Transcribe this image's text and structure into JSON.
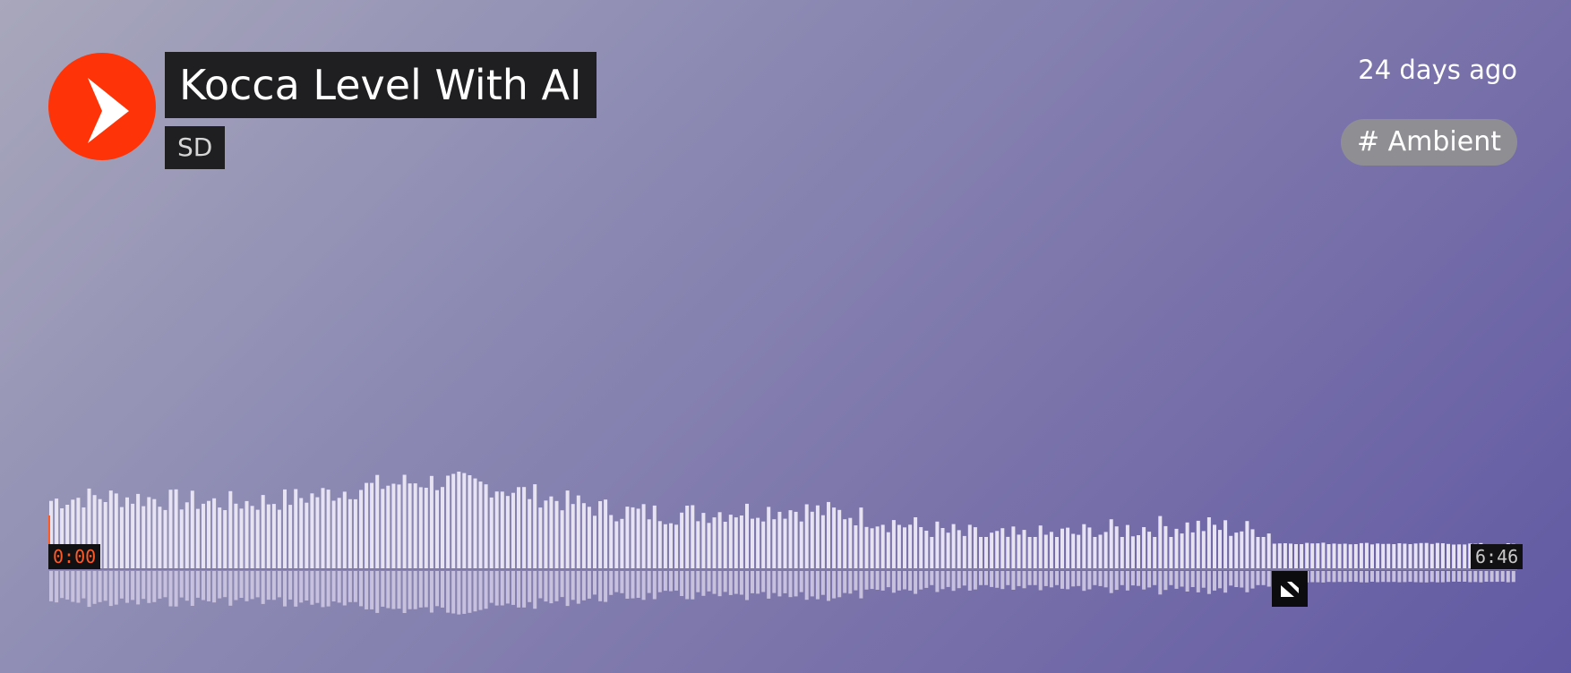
{
  "track": {
    "title": "Kocca Level With AI",
    "artist": "SD",
    "posted": "24 days ago",
    "tag": "# Ambient"
  },
  "player": {
    "current_time": "0:00",
    "duration": "6:46",
    "progress": 0,
    "played_color": "#ff5a26",
    "accent_color": "#fe3307"
  },
  "colors": {
    "title_bg": "#1f1f22",
    "tag_bg": "#8f8f93",
    "waveform_bar": "#e7e3f2"
  },
  "icons": [
    "play-icon",
    "comment-avatar-icon"
  ]
}
